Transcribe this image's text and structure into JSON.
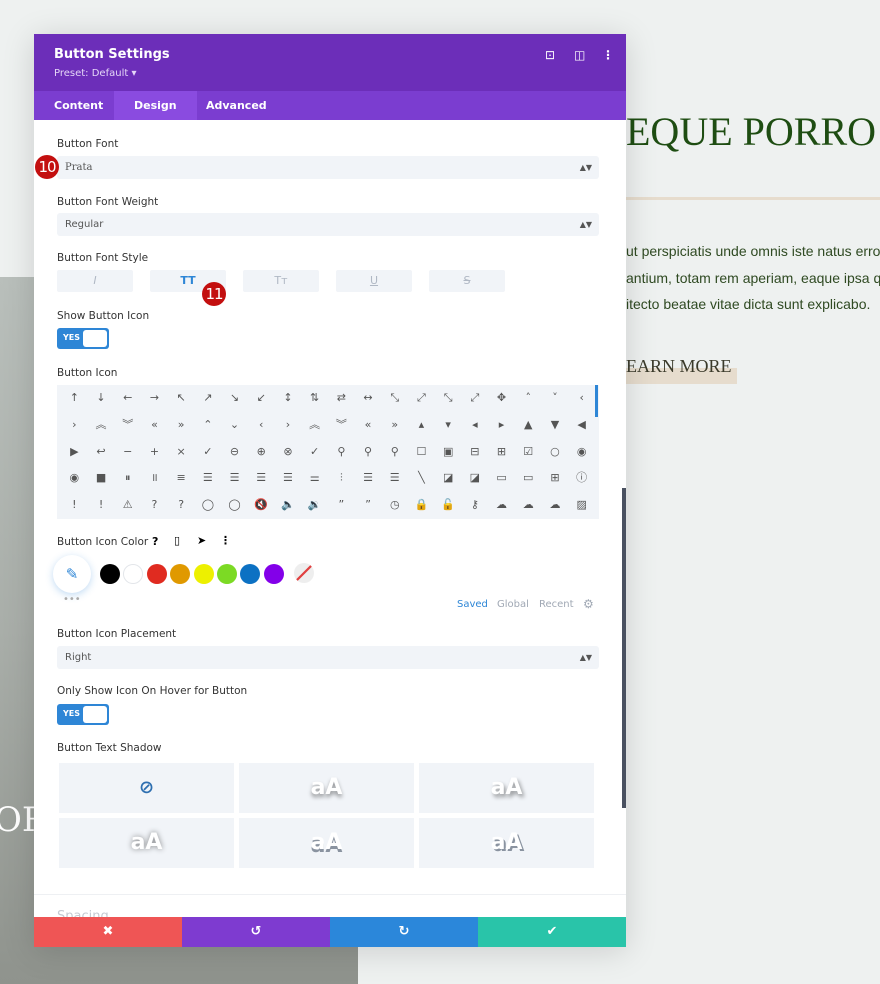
{
  "background": {
    "heading": "EQUE PORRO Q",
    "paragraph": [
      "ut perspiciatis unde omnis iste natus error",
      "antium, totam rem aperiam, eaque ipsa qu",
      "itecto beatae vitae dicta sunt explicabo."
    ],
    "button": "EARN MORE",
    "photo_text": "ORT"
  },
  "panel": {
    "title": "Button Settings",
    "preset": "Preset: Default ▾",
    "tabs": [
      {
        "label": "Content"
      },
      {
        "label": "Design"
      },
      {
        "label": "Advanced"
      }
    ],
    "active_tab": "Design",
    "header_icons": [
      "focus-icon",
      "split-view-icon",
      "more-icon"
    ],
    "button_font": {
      "label": "Button Font",
      "value": "Prata"
    },
    "font_weight": {
      "label": "Button Font Weight",
      "value": "Regular"
    },
    "font_style": {
      "label": "Button Font Style",
      "options": [
        "I",
        "TT",
        "Tᴛ",
        "U",
        "S"
      ],
      "active": "TT"
    },
    "show_icon": {
      "label": "Show Button Icon",
      "value": "YES"
    },
    "button_icon": {
      "label": "Button Icon",
      "icons": [
        "↑",
        "↓",
        "←",
        "→",
        "↖",
        "↗",
        "↘",
        "↙",
        "↕",
        "⇅",
        "⇄",
        "↔",
        "⤡",
        "⤢",
        "⤡",
        "⤢",
        "✥",
        "˄",
        "˅",
        "‹",
        "›",
        "︽",
        "︾",
        "«",
        "»",
        "⌃",
        "⌄",
        "‹",
        "›",
        "︽",
        "︾",
        "«",
        "»",
        "▴",
        "▾",
        "◂",
        "▸",
        "▲",
        "▼",
        "◀",
        "▶",
        "↩",
        "−",
        "+",
        "×",
        "✓",
        "⊖",
        "⊕",
        "⊗",
        "✓",
        "⚲",
        "⚲",
        "⚲",
        "☐",
        "▣",
        "⊟",
        "⊞",
        "☑",
        "○",
        "◉",
        "◉",
        "■",
        "⏸",
        "॥",
        "≡",
        "☰",
        "☰",
        "☰",
        "☰",
        "⚌",
        "⫶",
        "☰",
        "☰",
        "╲",
        "◪",
        "◪",
        "▭",
        "▭",
        "⊞",
        "ⓘ",
        "!",
        "!",
        "⚠",
        "?",
        "?",
        "◯",
        "◯",
        "🔇",
        "🔈",
        "🔉",
        "”",
        "”",
        "◷",
        "🔒",
        "🔓",
        "⚷",
        "☁",
        "☁",
        "☁",
        "▨"
      ]
    },
    "icon_color": {
      "label": "Button Icon Color",
      "label_icons": [
        "help-icon",
        "mobile-icon",
        "hover-cursor-icon",
        "more-icon"
      ],
      "swatches": [
        "#000000",
        "#ffffff",
        "#e02b20",
        "#e09900",
        "#edf000",
        "#7cda24",
        "#0c71c3",
        "#8300e9"
      ],
      "tabs": [
        "Saved",
        "Global",
        "Recent"
      ],
      "active_tab": "Saved"
    },
    "icon_placement": {
      "label": "Button Icon Placement",
      "value": "Right"
    },
    "hover_icon": {
      "label": "Only Show Icon On Hover for Button",
      "value": "YES"
    },
    "text_shadow": {
      "label": "Button Text Shadow",
      "options": [
        "none",
        "aA",
        "aA",
        "aA",
        "aA",
        "aA"
      ]
    },
    "next_section": "Spacing",
    "annotations": [
      "10",
      "11"
    ],
    "footer": {
      "cancel": "✖",
      "undo": "↺",
      "redo": "↻",
      "save": "✔"
    },
    "colors": {
      "header": "#6c2eb9",
      "tabs": "#7b3dd0",
      "cancel": "#ef5555",
      "undo": "#7e3bd0",
      "redo": "#2b87da",
      "save": "#29c4a9",
      "accent": "#2e86d6"
    }
  }
}
